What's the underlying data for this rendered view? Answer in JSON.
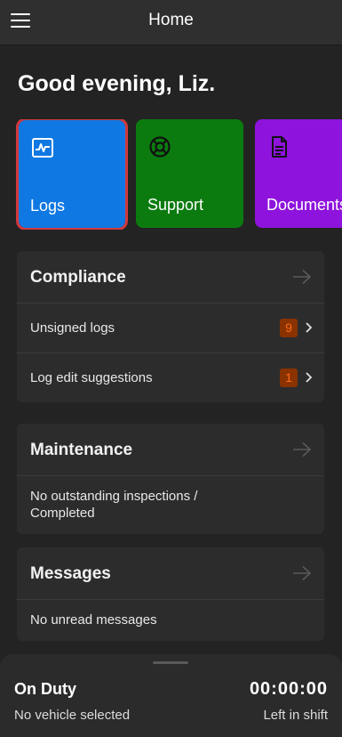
{
  "header": {
    "title": "Home",
    "menu_icon": "hamburger-menu-icon"
  },
  "greeting": "Good evening, Liz.",
  "tiles": [
    {
      "label": "Logs",
      "icon": "chart-line-icon",
      "color": "#0f78e2",
      "selected": true
    },
    {
      "label": "Support",
      "icon": "lifebuoy-icon",
      "color": "#0b7b10"
    },
    {
      "label": "Documents",
      "icon": "document-icon",
      "color": "#8e13dc"
    }
  ],
  "compliance": {
    "title": "Compliance",
    "rows": [
      {
        "label": "Unsigned logs",
        "count": "9"
      },
      {
        "label": "Log edit suggestions",
        "count": "1"
      }
    ]
  },
  "maintenance": {
    "title": "Maintenance",
    "text": "No outstanding inspections / Completed"
  },
  "messages": {
    "title": "Messages",
    "text": "No unread messages"
  },
  "status_bar": {
    "status": "On Duty",
    "vehicle": "No vehicle selected",
    "timer": "00:00:00",
    "timer_caption": "Left in shift"
  },
  "colors": {
    "badge_bg": "#8a3300",
    "badge_text": "#ff6a1a",
    "selected_outline": "#d0393e"
  }
}
